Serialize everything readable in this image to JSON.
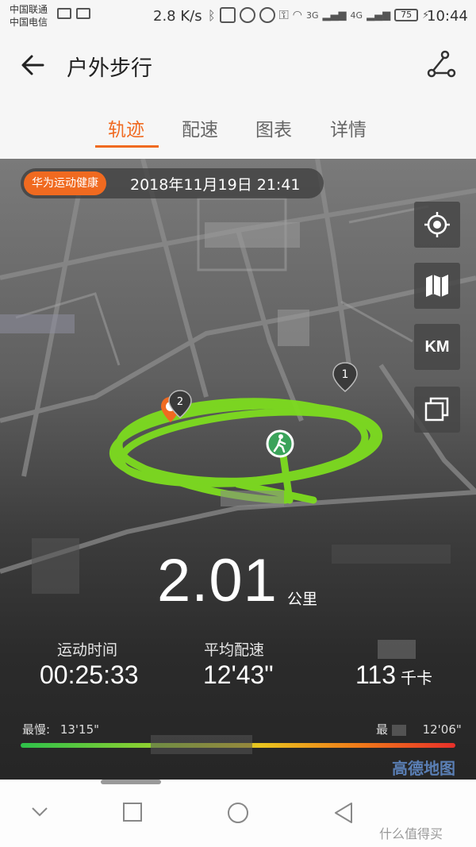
{
  "status_bar": {
    "carrier_1": "中国联通",
    "carrier_2": "中国电信",
    "net_speed": "2.8 K/s",
    "signal_1": "3G",
    "signal_2": "4G",
    "battery": "75",
    "time": "10:44"
  },
  "header": {
    "title": "户外步行",
    "back_icon": "arrow-left-icon",
    "share_icon": "share-nodes-icon"
  },
  "tabs": [
    {
      "label": "轨迹",
      "active": true
    },
    {
      "label": "配速",
      "active": false
    },
    {
      "label": "图表",
      "active": false
    },
    {
      "label": "详情",
      "active": false
    }
  ],
  "map": {
    "brand_badge": "华为运动健康",
    "datetime": "2018年11月19日 21:41",
    "buttons": {
      "locate_icon": "locate-crosshair-icon",
      "map_type_icon": "map-fold-icon",
      "km_label": "KM",
      "layers_icon": "layers-icon"
    },
    "markers": {
      "km_1": "1",
      "km_2": "2"
    },
    "track_color": "#7ddc1f",
    "provider_logo": "高德地图"
  },
  "summary": {
    "distance": "2.01",
    "distance_unit": "公里",
    "duration_label": "运动时间",
    "duration_value": "00:25:33",
    "pace_label": "平均配速",
    "pace_value": "12'43\"",
    "calories_value": "113",
    "calories_unit": "千卡",
    "slowest_label": "最慢:",
    "slowest_value": "13'15\"",
    "fastest_label": "最",
    "fastest_value": "12'06\""
  },
  "accent_color": "#f06a20",
  "watermark": "什么值得买"
}
